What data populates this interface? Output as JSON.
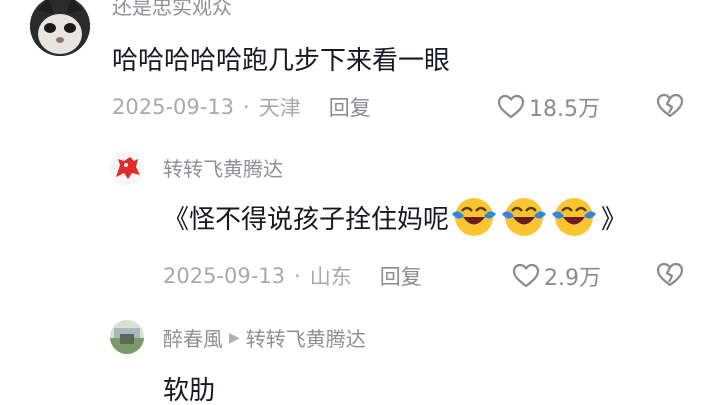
{
  "comments": [
    {
      "username": "还是忠实观众",
      "content": "哈哈哈哈哈跑几步下来看一眼",
      "date": "2025-09-13",
      "location": "天津",
      "reply_label": "回复",
      "likes": "18.5万"
    },
    {
      "username": "转转飞黄腾达",
      "content_prefix": "《怪不得说孩子拴住妈呢",
      "content_suffix": "》",
      "emojis": [
        "laughing-crying-emoji",
        "laughing-crying-emoji",
        "laughing-crying-emoji"
      ],
      "date": "2025-09-13",
      "location": "山东",
      "reply_label": "回复",
      "likes": "2.9万"
    },
    {
      "username": "醉春風",
      "reply_to": "转转飞黄腾达",
      "content": "软肋"
    }
  ],
  "colors": {
    "text": "#161823",
    "username": "#8f8f96",
    "meta": "#a8a8ae",
    "icon": "#8a8a90"
  }
}
